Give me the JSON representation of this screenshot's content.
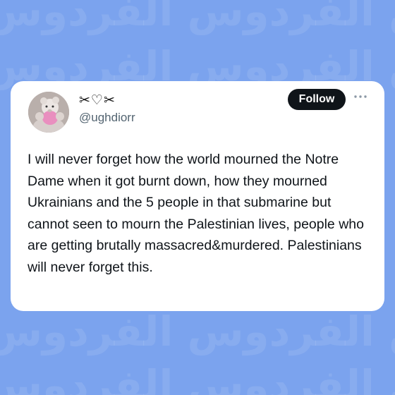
{
  "background": {
    "color": "#7ba3ee",
    "watermark_text": "الفردوس الفردوس الفردوس"
  },
  "tweet": {
    "display_name": "✂♡✂",
    "handle": "@ughdiorr",
    "follow_label": "Follow",
    "more_icon": "more-horizontal-icon",
    "text": "I will never forget how the world mourned the Notre Dame when it got burnt down, how they mourned Ukrainians and the 5 people in that submarine but cannot seen to mourn the Palestinian lives, people who are getting brutally massacred&murdered. Palestinians will never forget this."
  }
}
